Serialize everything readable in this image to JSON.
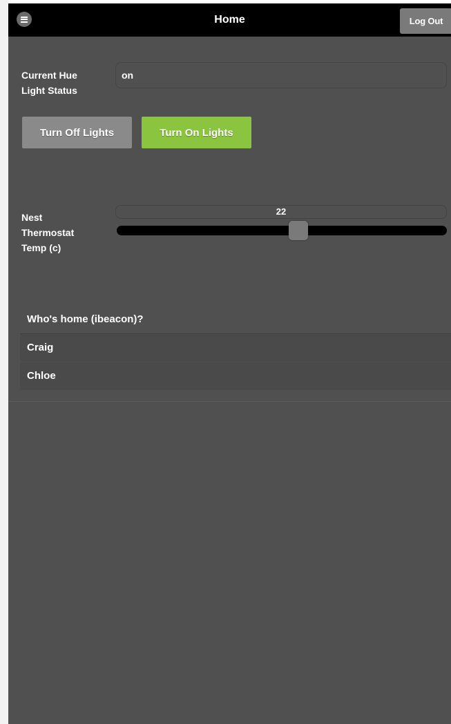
{
  "header": {
    "title": "Home",
    "logout_label": "Log Out",
    "menu_icon": "hamburger-menu-icon"
  },
  "hue": {
    "label_line1": "Current Hue",
    "label_line2": "Light Status",
    "status_value": "on",
    "off_button": "Turn Off Lights",
    "on_button": "Turn On Lights"
  },
  "nest": {
    "label_line1": "Nest",
    "label_line2": "Thermostat",
    "label_line3": "Temp (c)",
    "value": "22",
    "slider_fraction": 0.55
  },
  "presence": {
    "header": "Who's home (ibeacon)?",
    "people": [
      "Craig",
      "Chloe"
    ]
  },
  "colors": {
    "accent_green": "#8bc53f",
    "background": "#505050",
    "header_bg": "#000000"
  }
}
